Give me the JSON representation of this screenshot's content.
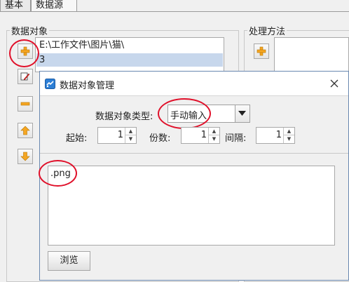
{
  "tabs": [
    {
      "label": "基本"
    },
    {
      "label": "数据源"
    }
  ],
  "left_group": {
    "title": "数据对象",
    "list_items": [
      {
        "text": "E:\\工作文件\\图片\\猫\\"
      },
      {
        "text": "3"
      }
    ]
  },
  "right_group": {
    "title": "处理方法"
  },
  "dialog": {
    "title": "数据对象管理",
    "type_label": "数据对象类型:",
    "type_value": "手动输入",
    "start_label": "起始:",
    "start_value": "1",
    "copies_label": "份数:",
    "copies_value": "1",
    "interval_label": "间隔:",
    "interval_value": "1",
    "content": ".png",
    "browse_label": "浏览"
  },
  "colors": {
    "highlight": "#e0102a",
    "selected_row": "#c7d7ec",
    "icon_orange": "#f5a623"
  },
  "icons": [
    "add-icon",
    "edit-icon",
    "remove-icon",
    "move-up-icon",
    "move-down-icon",
    "close-icon",
    "app-icon",
    "dropdown-arrow-icon"
  ]
}
